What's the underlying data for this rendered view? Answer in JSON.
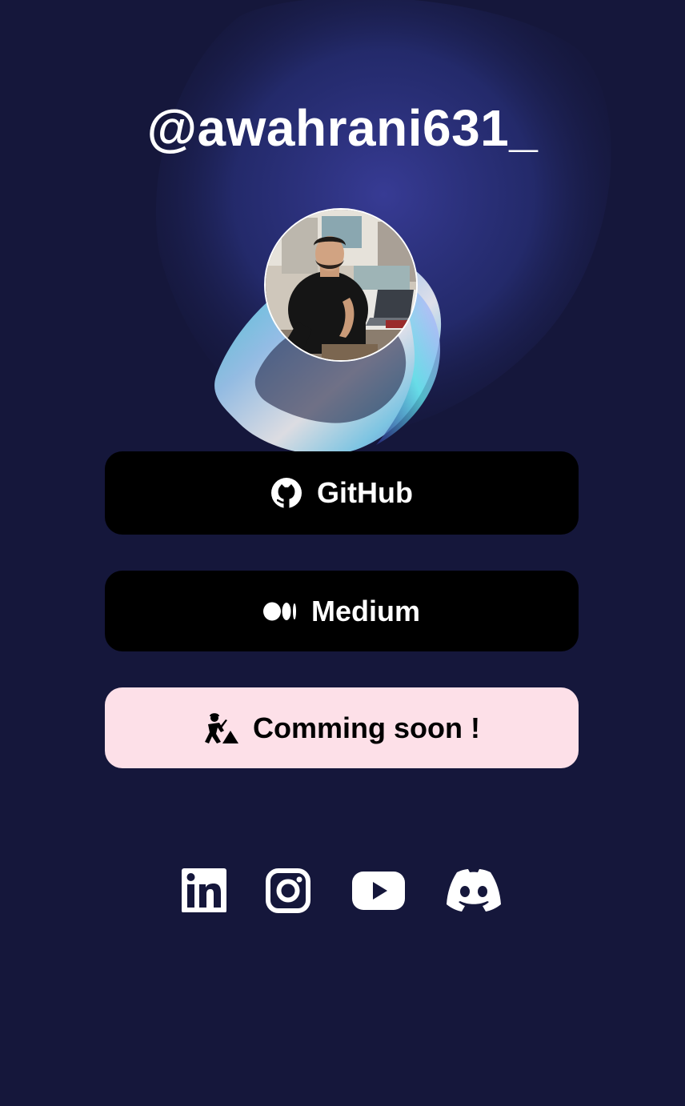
{
  "profile": {
    "handle": "@awahrani631_"
  },
  "links": [
    {
      "label": "GitHub",
      "icon": "github-icon"
    },
    {
      "label": "Medium",
      "icon": "medium-icon"
    },
    {
      "label": "Comming soon !",
      "icon": "construction-worker-icon"
    }
  ],
  "socials": [
    {
      "icon": "linkedin-icon"
    },
    {
      "icon": "instagram-icon"
    },
    {
      "icon": "youtube-icon"
    },
    {
      "icon": "discord-icon"
    }
  ],
  "colors": {
    "background": "#15173b",
    "button_dark": "#000000",
    "button_soon": "#fde0e8",
    "text_light": "#ffffff"
  }
}
